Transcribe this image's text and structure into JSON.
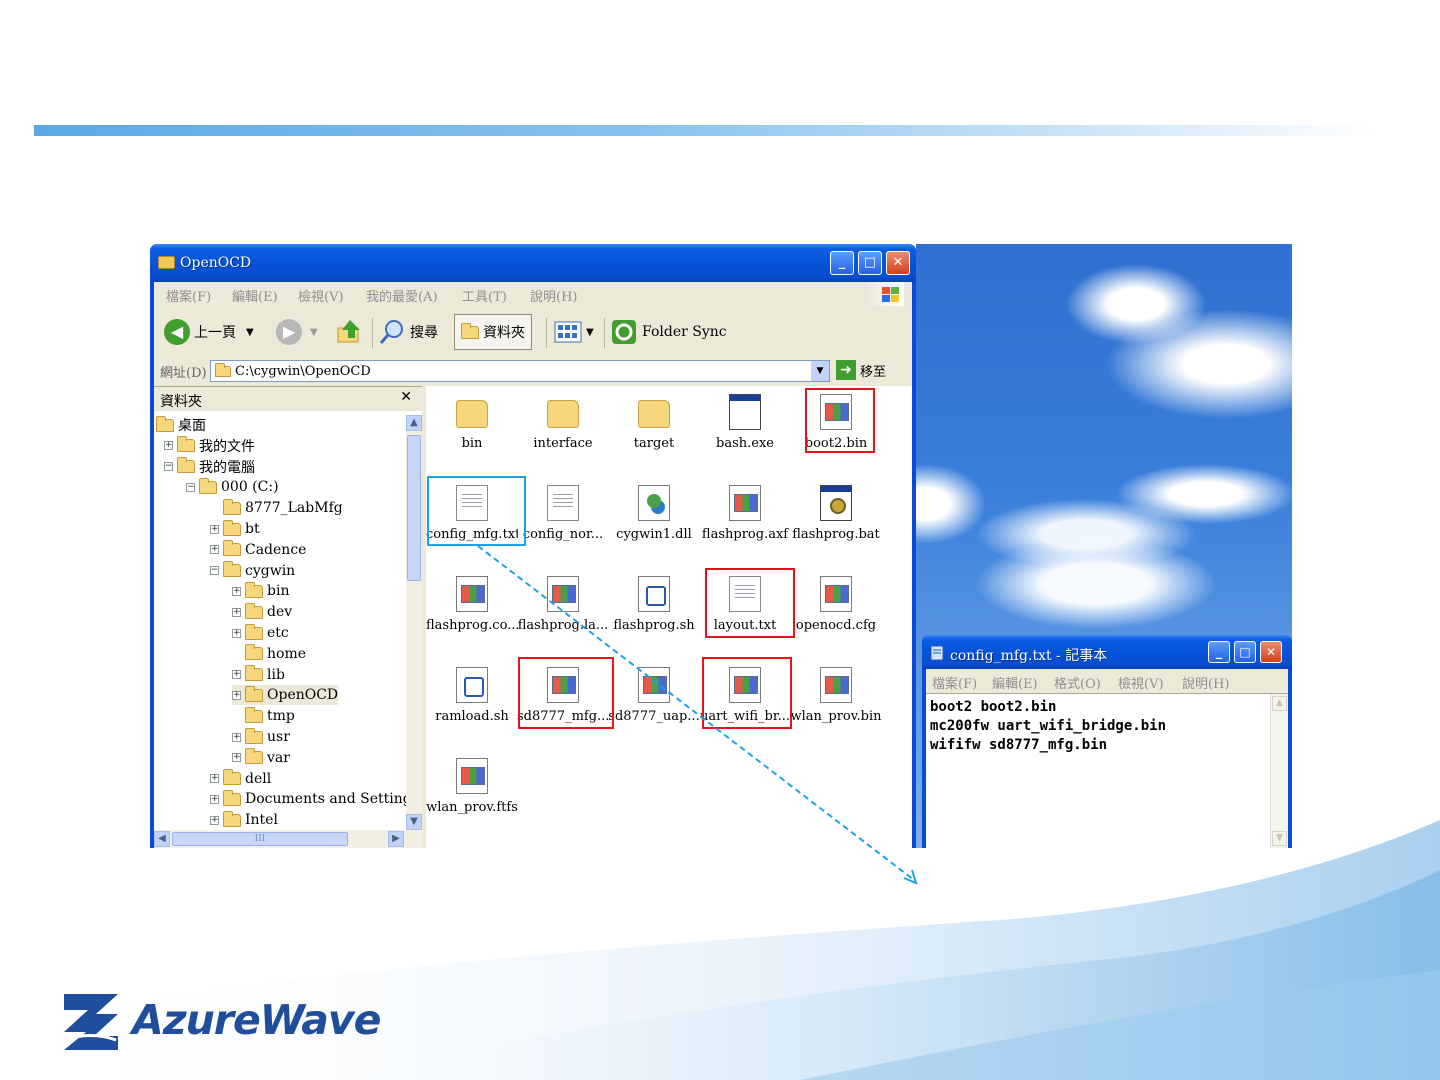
{
  "slide": {
    "logo_text": "AzureWave"
  },
  "explorer": {
    "title": "OpenOCD",
    "menu": [
      "檔案(F)",
      "編輯(E)",
      "檢視(V)",
      "我的最愛(A)",
      "工具(T)",
      "說明(H)"
    ],
    "toolbar": {
      "back_label": "上一頁",
      "search_label": "搜尋",
      "folders_label": "資料夾",
      "folder_sync_label": "Folder Sync"
    },
    "address": {
      "label": "網址(D)",
      "value": "C:\\cygwin\\OpenOCD",
      "go_label": "移至"
    },
    "folder_pane": {
      "title": "資料夾",
      "close": "✕",
      "tree": [
        {
          "label": "桌面",
          "expander": ""
        },
        {
          "label": "我的文件",
          "expander": "+"
        },
        {
          "label": "我的電腦",
          "expander": "−"
        },
        {
          "label": "000 (C:)",
          "expander": "−"
        },
        {
          "label": "8777_LabMfg",
          "expander": ""
        },
        {
          "label": "bt",
          "expander": "+"
        },
        {
          "label": "Cadence",
          "expander": "+"
        },
        {
          "label": "cygwin",
          "expander": "−"
        },
        {
          "label": "bin",
          "expander": "+"
        },
        {
          "label": "dev",
          "expander": "+"
        },
        {
          "label": "etc",
          "expander": "+"
        },
        {
          "label": "home",
          "expander": ""
        },
        {
          "label": "lib",
          "expander": "+"
        },
        {
          "label": "OpenOCD",
          "expander": "+"
        },
        {
          "label": "tmp",
          "expander": ""
        },
        {
          "label": "usr",
          "expander": "+"
        },
        {
          "label": "var",
          "expander": "+"
        },
        {
          "label": "dell",
          "expander": "+"
        },
        {
          "label": "Documents and Settings",
          "expander": "+"
        },
        {
          "label": "Intel",
          "expander": "+"
        }
      ],
      "hscroll_thumb": "III"
    },
    "files": [
      {
        "name": "bin",
        "type": "folder"
      },
      {
        "name": "interface",
        "type": "folder"
      },
      {
        "name": "target",
        "type": "folder"
      },
      {
        "name": "bash.exe",
        "type": "exe"
      },
      {
        "name": "boot2.bin",
        "type": "bin"
      },
      {
        "name": "config_mfg.txt",
        "type": "doc"
      },
      {
        "name": "config_nor...",
        "type": "doc"
      },
      {
        "name": "cygwin1.dll",
        "type": "dll"
      },
      {
        "name": "flashprog.axf",
        "type": "bin"
      },
      {
        "name": "flashprog.bat",
        "type": "bat"
      },
      {
        "name": "flashprog.co...",
        "type": "bin"
      },
      {
        "name": "flashprog.la...",
        "type": "bin"
      },
      {
        "name": "flashprog.sh",
        "type": "sh"
      },
      {
        "name": "layout.txt",
        "type": "doc"
      },
      {
        "name": "openocd.cfg",
        "type": "bin"
      },
      {
        "name": "ramload.sh",
        "type": "sh"
      },
      {
        "name": "sd8777_mfg....",
        "type": "bin"
      },
      {
        "name": "sd8777_uap...",
        "type": "bin"
      },
      {
        "name": "uart_wifi_br...",
        "type": "bin"
      },
      {
        "name": "wlan_prov.bin",
        "type": "bin"
      },
      {
        "name": "wlan_prov.ftfs",
        "type": "bin"
      }
    ]
  },
  "notepad": {
    "title": "config_mfg.txt - 記事本",
    "menu": [
      "檔案(F)",
      "編輯(E)",
      "格式(O)",
      "檢視(V)",
      "說明(H)"
    ],
    "content": "boot2 boot2.bin\nmc200fw uart_wifi_bridge.bin\nwififw sd8777_mfg.bin"
  },
  "colors": {
    "highlight_red": "#e8121d",
    "highlight_blue": "#1ea3e0",
    "title_blue": "#0552d6"
  }
}
